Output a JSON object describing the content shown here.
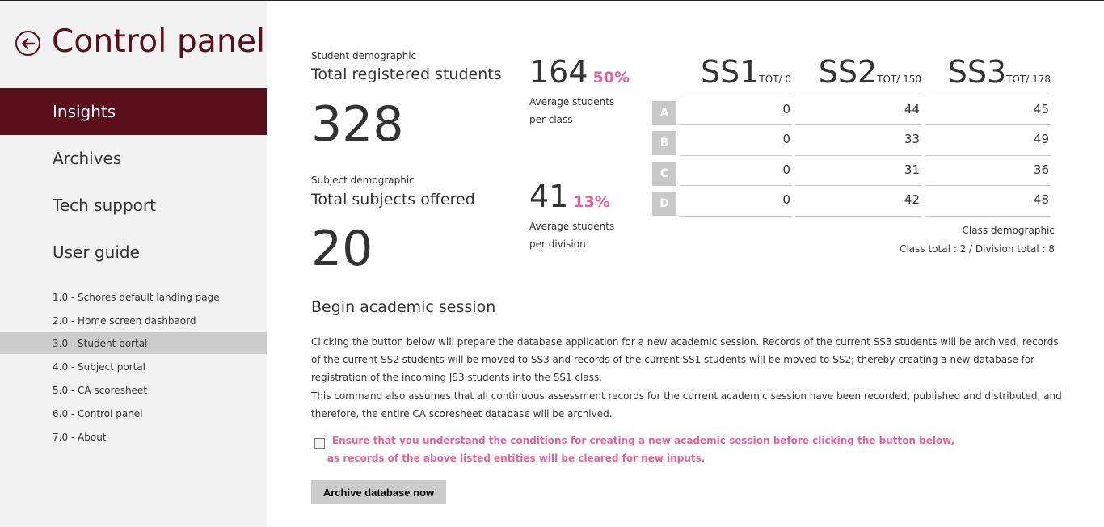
{
  "sidebar": {
    "title": "Control panel",
    "nav": [
      {
        "label": "Insights",
        "active": true
      },
      {
        "label": "Archives",
        "active": false
      },
      {
        "label": "Tech support",
        "active": false
      },
      {
        "label": "User guide",
        "active": false
      }
    ],
    "guide": [
      {
        "label": "1.0 - Schores default landing page"
      },
      {
        "label": "2.0 - Home screen dashbaord"
      },
      {
        "label": "3.0 - Student portal",
        "selected": true
      },
      {
        "label": "4.0 - Subject portal"
      },
      {
        "label": "5.0 - CA scoresheet"
      },
      {
        "label": "6.0 - Control panel"
      },
      {
        "label": "7.0 - About"
      }
    ]
  },
  "students": {
    "caption": "Student demographic",
    "label": "Total registered students",
    "total": "328",
    "avg_value": "164",
    "avg_pct": "50%",
    "avg_caption_1": "Average students",
    "avg_caption_2": "per class"
  },
  "subjects": {
    "caption": "Subject demographic",
    "label": "Total subjects offered",
    "total": "20",
    "avg_value": "41",
    "avg_pct": "13%",
    "avg_caption_1": "Average students",
    "avg_caption_2": "per division"
  },
  "class_table": {
    "columns": [
      {
        "name": "SS1",
        "tot": "TOT/ 0"
      },
      {
        "name": "SS2",
        "tot": "TOT/ 150"
      },
      {
        "name": "SS3",
        "tot": "TOT/ 178"
      }
    ],
    "rows": [
      {
        "label": "A",
        "values": [
          "0",
          "44",
          "45"
        ]
      },
      {
        "label": "B",
        "values": [
          "0",
          "33",
          "49"
        ]
      },
      {
        "label": "C",
        "values": [
          "0",
          "31",
          "36"
        ]
      },
      {
        "label": "D",
        "values": [
          "0",
          "42",
          "48"
        ]
      }
    ],
    "caption": "Class demographic",
    "totals": "Class total : 2 / Division total : 8"
  },
  "session": {
    "title": "Begin academic session",
    "para1": "Clicking the button below will prepare the database application for a new academic session. Records of the current SS3 students will be archived, records of the current SS2 students will be moved to SS3 and records of the current SS1 students will be moved to SS2; thereby creating a new database for registration of the incoming JS3 students into the SS1 class.",
    "para2": "This command also assumes that all continuous assessment records for the current academic session have been recorded, published and distributed, and therefore, the entire CA scoresheet database will be archived.",
    "warning_line1": "Ensure that you understand the conditions for creating a new academic session before clicking the button below,",
    "warning_line2": "as records of the above listed entities will be cleared for new inputs.",
    "checkbox_checked": false,
    "button_label": "Archive database now"
  },
  "colors": {
    "brand": "#5a0f1a",
    "accent_pink": "#e8609a",
    "sidebar_bg": "#f2f2f2",
    "badge_gray": "#c8c8c8"
  },
  "icons": {
    "back": "arrow-left-circle-icon"
  }
}
